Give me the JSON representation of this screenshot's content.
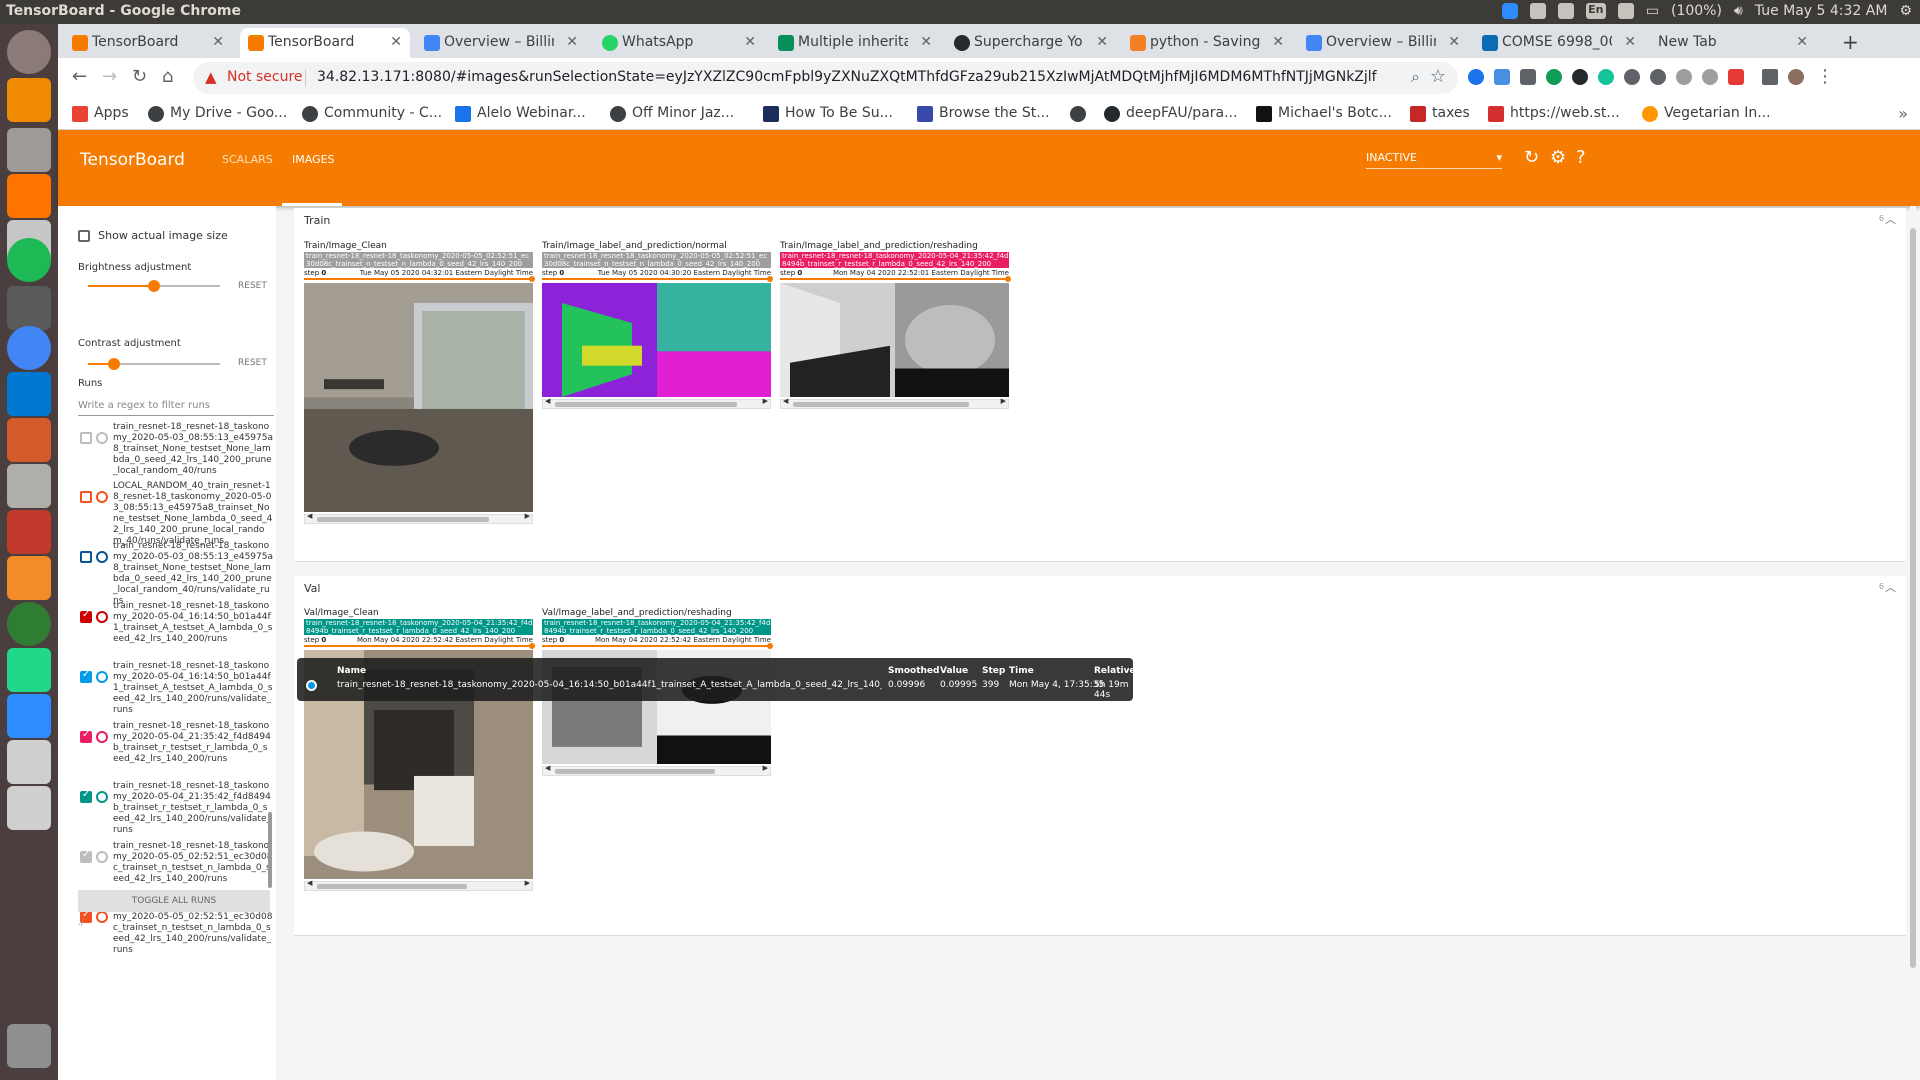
{
  "os": {
    "window_title": "TensorBoard - Google Chrome",
    "lang": "En",
    "battery": "(100%)",
    "clock": "Tue May  5  4:32 AM"
  },
  "browser": {
    "tabs": [
      {
        "label": "TensorBoard",
        "active": false,
        "color": "#f57c00"
      },
      {
        "label": "TensorBoard",
        "active": true,
        "color": "#f57c00"
      },
      {
        "label": "Overview – Billin",
        "active": false,
        "color": "#4285f4"
      },
      {
        "label": "WhatsApp",
        "active": false,
        "color": "#25d366"
      },
      {
        "label": "Multiple inherita",
        "active": false,
        "color": "#0a8f5a"
      },
      {
        "label": "Supercharge Yo",
        "active": false,
        "color": "#24292e"
      },
      {
        "label": "python - Saving",
        "active": false,
        "color": "#f48024"
      },
      {
        "label": "Overview – Billin",
        "active": false,
        "color": "#4285f4"
      },
      {
        "label": "COMSE 6998_00",
        "active": false,
        "color": "#0b6cb4"
      },
      {
        "label": "New Tab",
        "active": false,
        "color": "#dee1e6"
      }
    ],
    "not_secure": "Not secure",
    "url": "34.82.13.171:8080/#images&runSelectionState=eyJzYXZlZC90cmFpbl9yZXNuZXQtMThfdGFza29ub215XzIwMjAtMDQtMjhfMjI6MDM6MThfNTJjMGNkZjlfdHJhaW5z...",
    "bookmarks": [
      "Apps",
      "My Drive - Goo...",
      "Community - C...",
      "Alelo Webinar...",
      "Off Minor Jaz...",
      "How To Be Su...",
      "Browse the St...",
      "",
      "deepFAU/para...",
      "Michael's Botc...",
      "taxes",
      "https://web.st...",
      "Vegetarian In..."
    ]
  },
  "tensorboard": {
    "brand": "TensorBoard",
    "nav": [
      "SCALARS",
      "IMAGES"
    ],
    "active_nav": "IMAGES",
    "status_select": "INACTIVE",
    "sidebar": {
      "show_actual_size": "Show actual image size",
      "brightness_label": "Brightness adjustment",
      "brightness_value": 0.5,
      "contrast_label": "Contrast adjustment",
      "contrast_value": 0.2,
      "reset": "RESET",
      "runs_label": "Runs",
      "filter_placeholder": "Write a regex to filter runs",
      "runs": [
        {
          "text": "train_resnet-18_resnet-18_taskonomy_2020-05-03_08:55:13_e45975a8_trainset_None_testset_None_lambda_0_seed_42_lrs_140_200_prune_local_random_40/runs",
          "checked": false,
          "color": "#bdbdbd"
        },
        {
          "text": "LOCAL_RANDOM_40_train_resnet-18_resnet-18_taskonomy_2020-05-03_08:55:13_e45975a8_trainset_None_testset_None_lambda_0_seed_42_lrs_140_200_prune_local_random_40/runs/validate_runs",
          "checked": false,
          "color": "#f4511e"
        },
        {
          "text": "train_resnet-18_resnet-18_taskonomy_2020-05-03_08:55:13_e45975a8_trainset_None_testset_None_lambda_0_seed_42_lrs_140_200_prune_local_random_40/runs/validate_runs",
          "checked": false,
          "color": "#0b5394"
        },
        {
          "text": "train_resnet-18_resnet-18_taskonomy_2020-05-04_16:14:50_b01a44f1_trainset_A_testset_A_lambda_0_seed_42_lrs_140_200/runs",
          "checked": true,
          "color": "#cc0000"
        },
        {
          "text": "train_resnet-18_resnet-18_taskonomy_2020-05-04_16:14:50_b01a44f1_trainset_A_testset_A_lambda_0_seed_42_lrs_140_200/runs/validate_runs",
          "checked": true,
          "color": "#039be5"
        },
        {
          "text": "train_resnet-18_resnet-18_taskonomy_2020-05-04_21:35:42_f4d8494b_trainset_r_testset_r_lambda_0_seed_42_lrs_140_200/runs",
          "checked": true,
          "color": "#e91e63"
        },
        {
          "text": "train_resnet-18_resnet-18_taskonomy_2020-05-04_21:35:42_f4d8494b_trainset_r_testset_r_lambda_0_seed_42_lrs_140_200/runs/validate_runs",
          "checked": true,
          "color": "#009688"
        },
        {
          "text": "train_resnet-18_resnet-18_taskonomy_2020-05-05_02:52:51_ec30d08c_trainset_n_testset_n_lambda_0_seed_42_lrs_140_200/runs",
          "checked": true,
          "color": "#bdbdbd"
        },
        {
          "text": "train_resnet-18_resnet-18_taskonomy_2020-05-05_02:52:51_ec30d08c_trainset_n_testset_n_lambda_0_seed_42_lrs_140_200/runs/validate_runs",
          "checked": true,
          "color": "#f4511e"
        }
      ],
      "toggle_all": "TOGGLE ALL RUNS",
      "footer": "./"
    },
    "sections": {
      "train": {
        "name": "Train",
        "count": "6",
        "cards": [
          {
            "title": "Train/Image_Clean",
            "run": "train_resnet-18_resnet-18_taskonomy_2020-05-05_02:52:51_ec30d08c_trainset_n_testset_n_lambda_0_seed_42_lrs_140_200",
            "badge_color": "#9e9e9e",
            "step_label": "step",
            "step": "0",
            "time": "Tue May 05 2020 04:32:01 Eastern Daylight Time"
          },
          {
            "title": "Train/Image_label_and_prediction/normal",
            "run": "train_resnet-18_resnet-18_taskonomy_2020-05-05_02:52:51_ec30d08c_trainset_n_testset_n_lambda_0_seed_42_lrs_140_200",
            "badge_color": "#9e9e9e",
            "step_label": "step",
            "step": "0",
            "time": "Tue May 05 2020 04:30:20 Eastern Daylight Time"
          },
          {
            "title": "Train/Image_label_and_prediction/reshading",
            "run": "train_resnet-18_resnet-18_taskonomy_2020-05-04_21:35:42_f4d8494b_trainset_r_testset_r_lambda_0_seed_42_lrs_140_200",
            "badge_color": "#e91e63",
            "step_label": "step",
            "step": "0",
            "time": "Mon May 04 2020 22:52:01 Eastern Daylight Time"
          }
        ]
      },
      "val": {
        "name": "Val",
        "count": "6",
        "cards": [
          {
            "title": "Val/Image_Clean",
            "run": "train_resnet-18_resnet-18_taskonomy_2020-05-04_21:35:42_f4d8494b_trainset_r_testset_r_lambda_0_seed_42_lrs_140_200",
            "badge_color": "#009688",
            "step_label": "step",
            "step": "0",
            "time": "Mon May 04 2020 22:52:42 Eastern Daylight Time"
          },
          {
            "title": "Val/Image_label_and_prediction/reshading",
            "run": "train_resnet-18_resnet-18_taskonomy_2020-05-04_21:35:42_f4d8494b_trainset_r_testset_r_lambda_0_seed_42_lrs_140_200",
            "badge_color": "#009688",
            "step_label": "step",
            "step": "0",
            "time": "Mon May 04 2020 22:52:42 Eastern Daylight Time"
          }
        ]
      }
    },
    "tooltip": {
      "headers": [
        "Name",
        "Smoothed",
        "Value",
        "Step",
        "Time",
        "Relative"
      ],
      "row": {
        "name": "train_resnet-18_resnet-18_taskonomy_2020-05-04_16:14:50_b01a44f1_trainset_A_testset_A_lambda_0_seed_42_lrs_140_200/runs/validate_runs",
        "smoothed": "0.09996",
        "value": "0.09995",
        "step": "399",
        "time": "Mon May 4, 17:35:35",
        "relative": "5h 19m 44s",
        "color": "#039be5"
      }
    }
  }
}
